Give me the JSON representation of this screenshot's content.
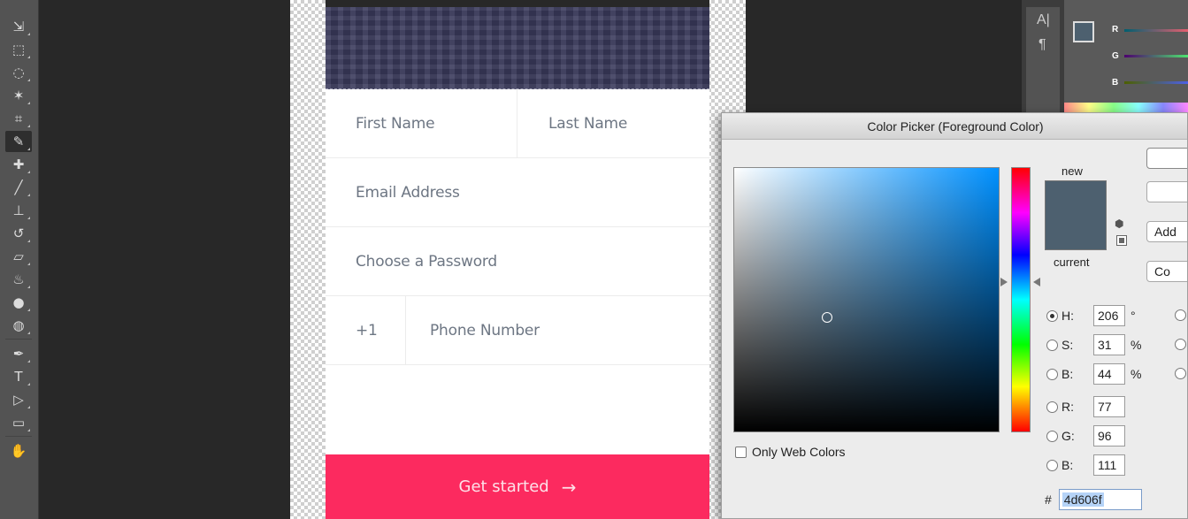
{
  "form": {
    "first_name_placeholder": "First Name",
    "last_name_placeholder": "Last Name",
    "email_placeholder": "Email Address",
    "password_placeholder": "Choose a Password",
    "country_code": "+1",
    "phone_placeholder": "Phone Number",
    "cta_label": "Get started",
    "cta_arrow": "→",
    "cta_color": "#fc2a5f"
  },
  "panel": {
    "char_tool_a": "A|",
    "char_tool_para": "¶",
    "channels": [
      "R",
      "G",
      "B"
    ]
  },
  "color_picker": {
    "title": "Color Picker (Foreground Color)",
    "new_label": "new",
    "current_label": "current",
    "color": "#4d606f",
    "only_web_colors_label": "Only Web Colors",
    "only_web_colors_checked": false,
    "add_button_label": "Add",
    "color_libraries_button_label": "Co",
    "fields": {
      "H": {
        "label": "H:",
        "value": "206",
        "unit": "°",
        "selected": true
      },
      "S": {
        "label": "S:",
        "value": "31",
        "unit": "%",
        "selected": false
      },
      "Bv": {
        "label": "B:",
        "value": "44",
        "unit": "%",
        "selected": false
      },
      "R": {
        "label": "R:",
        "value": "77",
        "unit": "",
        "selected": false
      },
      "G": {
        "label": "G:",
        "value": "96",
        "unit": "",
        "selected": false
      },
      "Bl": {
        "label": "B:",
        "value": "111",
        "unit": "",
        "selected": false
      }
    },
    "hex_label": "#",
    "hex_value": "4d606f"
  },
  "toolbar": {
    "tools": [
      "move-icon",
      "marquee-icon",
      "lasso-icon",
      "magic-wand-icon",
      "crop-icon",
      "eyedropper-icon",
      "healing-brush-icon",
      "brush-icon",
      "clone-stamp-icon",
      "history-brush-icon",
      "eraser-icon",
      "paint-bucket-icon",
      "blur-icon",
      "dodge-icon",
      "pen-icon",
      "type-icon",
      "path-select-icon",
      "rectangle-icon",
      "hand-icon"
    ],
    "active_tool": "eyedropper-icon"
  }
}
